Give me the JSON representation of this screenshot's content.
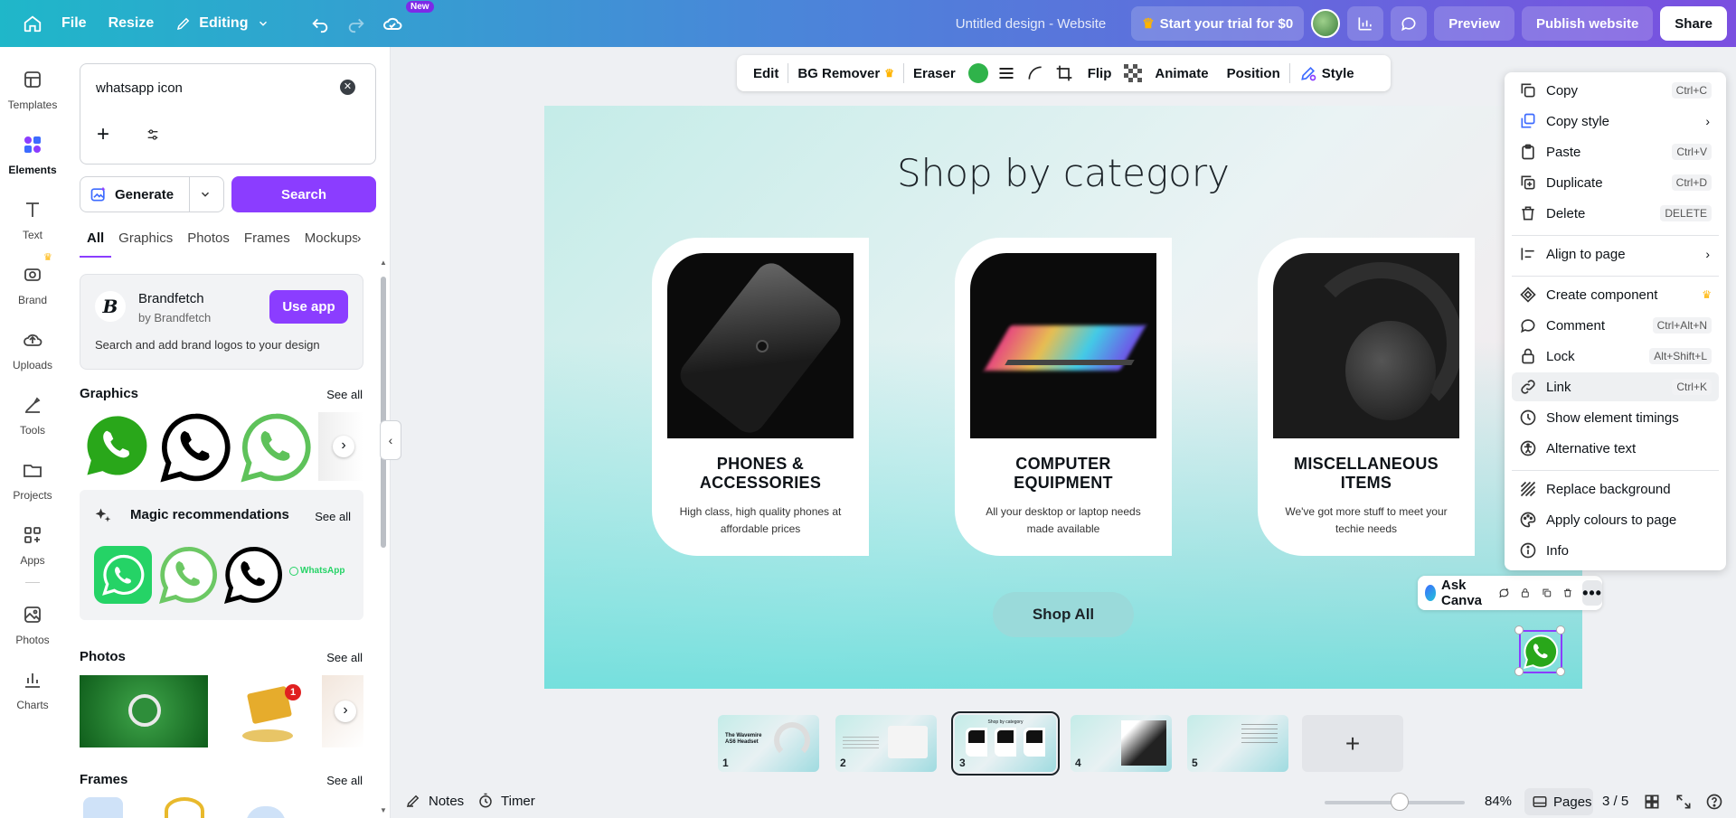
{
  "topbar": {
    "file": "File",
    "resize": "Resize",
    "editing": "Editing",
    "new_badge": "New",
    "doc_title": "Untitled design - Website",
    "trial": "Start your trial for $0",
    "preview": "Preview",
    "publish": "Publish website",
    "share": "Share"
  },
  "rail": [
    {
      "label": "Templates"
    },
    {
      "label": "Elements"
    },
    {
      "label": "Text"
    },
    {
      "label": "Brand"
    },
    {
      "label": "Uploads"
    },
    {
      "label": "Tools"
    },
    {
      "label": "Projects"
    },
    {
      "label": "Apps"
    },
    {
      "label": "Photos"
    },
    {
      "label": "Charts"
    }
  ],
  "panel": {
    "search_value": "whatsapp icon",
    "generate": "Generate",
    "search": "Search",
    "tabs": [
      "All",
      "Graphics",
      "Photos",
      "Frames",
      "Mockups"
    ],
    "brand_card": {
      "name": "Brandfetch",
      "by": "by Brandfetch",
      "desc": "Search and add brand logos to your design",
      "button": "Use app"
    },
    "graphics_title": "Graphics",
    "magic_title": "Magic recommendations",
    "photos_title": "Photos",
    "frames_title": "Frames",
    "see_all": "See all",
    "whatsapp_text": "WhatsApp",
    "notification_count": "1"
  },
  "toolbar": {
    "edit": "Edit",
    "bg_remover": "BG Remover",
    "eraser": "Eraser",
    "flip": "Flip",
    "animate": "Animate",
    "position": "Position",
    "style": "Style",
    "color": "#2fb34a"
  },
  "canvas": {
    "title": "Shop by category",
    "cards": [
      {
        "title": "PHONES & ACCESSORIES",
        "desc": "High class, high quality phones at affordable prices"
      },
      {
        "title": "COMPUTER EQUIPMENT",
        "desc": "All your desktop or laptop needs made available"
      },
      {
        "title": "MISCELLANEOUS ITEMS",
        "desc": "We've got more stuff to meet your techie needs"
      }
    ],
    "shop_all": "Shop All"
  },
  "ask_canva": "Ask Canva",
  "context_menu": [
    {
      "label": "Copy",
      "shortcut": "Ctrl+C"
    },
    {
      "label": "Copy style",
      "shortcut": ""
    },
    {
      "label": "Paste",
      "shortcut": "Ctrl+V"
    },
    {
      "label": "Duplicate",
      "shortcut": "Ctrl+D"
    },
    {
      "label": "Delete",
      "shortcut": "DELETE"
    },
    {
      "label": "Align to page",
      "shortcut": ""
    },
    {
      "label": "Create component",
      "shortcut": ""
    },
    {
      "label": "Comment",
      "shortcut": "Ctrl+Alt+N"
    },
    {
      "label": "Lock",
      "shortcut": "Alt+Shift+L"
    },
    {
      "label": "Link",
      "shortcut": "Ctrl+K"
    },
    {
      "label": "Show element timings",
      "shortcut": ""
    },
    {
      "label": "Alternative text",
      "shortcut": ""
    },
    {
      "label": "Replace background",
      "shortcut": ""
    },
    {
      "label": "Apply colours to page",
      "shortcut": ""
    },
    {
      "label": "Info",
      "shortcut": ""
    }
  ],
  "thumb_text": {
    "t1_title": "The Wavemire AS6 Headset",
    "t3_title": "Shop by category"
  },
  "pages": [
    "1",
    "2",
    "3",
    "4",
    "5"
  ],
  "bottom": {
    "notes": "Notes",
    "timer": "Timer",
    "zoom": "84%",
    "pages": "Pages",
    "page_indicator": "3 / 5"
  }
}
